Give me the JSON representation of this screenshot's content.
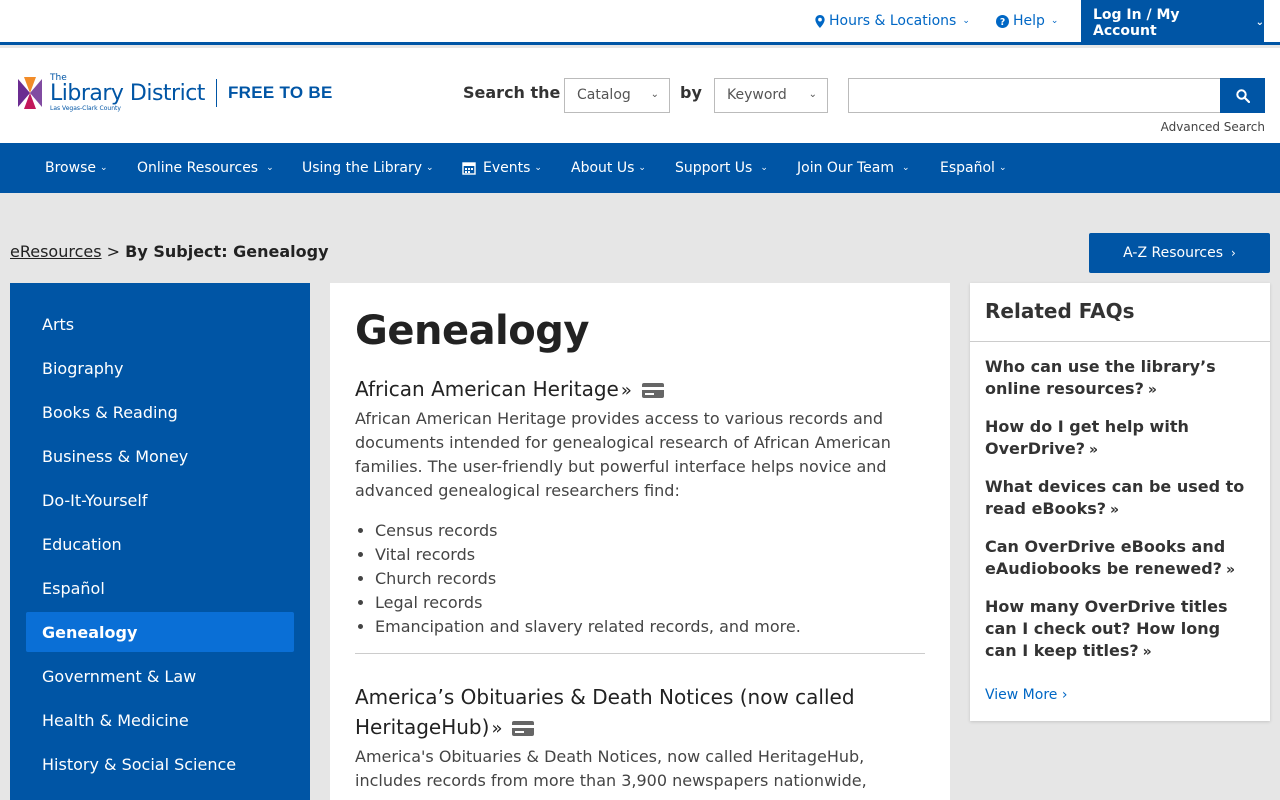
{
  "utility": {
    "hours_label": "Hours & Locations",
    "help_label": "Help",
    "login_label": "Log In / My Account"
  },
  "header": {
    "logo_the": "The",
    "logo_name": "Library District",
    "logo_sub": "Las Vegas-Clark County",
    "logo_tag": "FREE TO BE",
    "search_label": "Search the",
    "catalog_select": "Catalog",
    "by_label": "by",
    "keyword_select": "Keyword",
    "search_value": "",
    "advanced_search": "Advanced Search"
  },
  "nav": {
    "browse": "Browse",
    "online_resources": "Online Resources",
    "using_library": "Using the Library",
    "events": "Events",
    "about_us": "About Us",
    "support_us": "Support Us",
    "join_team": "Join Our Team",
    "espanol": "Español"
  },
  "breadcrumb": {
    "parent": "eResources",
    "separator": ">",
    "current": "By Subject: Genealogy"
  },
  "az_button": "A-Z Resources",
  "sidebar": {
    "items": [
      "Arts",
      "Biography",
      "Books & Reading",
      "Business & Money",
      "Do-It-Yourself",
      "Education",
      "Español",
      "Genealogy",
      "Government & Law",
      "Health & Medicine",
      "History & Social Science"
    ],
    "active": "Genealogy"
  },
  "content": {
    "title": "Genealogy",
    "resources": [
      {
        "title": "African American Heritage",
        "description": "African American Heritage provides access to various records and documents intended for genealogical research of African American families. The user-friendly but powerful interface helps novice and advanced genealogical researchers find:",
        "list": [
          "Census records",
          "Vital records",
          "Church records",
          "Legal records",
          "Emancipation and slavery related records, and more."
        ]
      },
      {
        "title": "America’s Obituaries & Death Notices (now called HeritageHub)",
        "description": "America's Obituaries & Death Notices, now called HeritageHub, includes records from more than 3,900 newspapers nationwide,"
      }
    ]
  },
  "faq": {
    "heading": "Related FAQs",
    "items": [
      "Who can use the library’s online resources?",
      "How do I get help with OverDrive?",
      "What devices can be used to read eBooks?",
      "Can OverDrive eBooks and eAudiobooks be renewed?",
      "How many OverDrive titles can I check out? How long can I keep titles?"
    ],
    "view_more": "View More"
  },
  "colors": {
    "brand_blue": "#0055a5",
    "active_blue": "#0a6fd6",
    "link_blue": "#0067c5",
    "logo_purple": "#6b2c91",
    "logo_orange": "#f28c28"
  },
  "icons": [
    "map-marker-icon",
    "question-circle-icon",
    "chevron-down-icon",
    "search-icon",
    "calendar-icon",
    "chevron-right-icon",
    "double-chevron-right-icon",
    "library-card-icon"
  ]
}
